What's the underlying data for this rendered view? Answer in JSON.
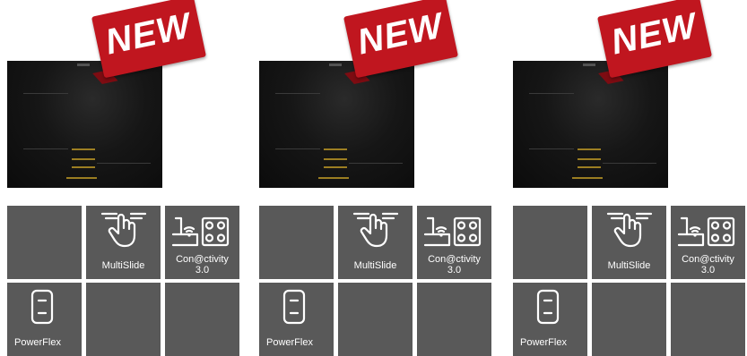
{
  "products": [
    {
      "badge": "NEW",
      "features": [
        {
          "label": "",
          "icon": ""
        },
        {
          "label": "MultiSlide",
          "icon": "multislide-hand-icon"
        },
        {
          "label": "Con@ctivity\n3.0",
          "icon": "connectivity-hood-hob-icon"
        },
        {
          "label": "PowerFlex",
          "icon": "powerflex-zone-icon"
        },
        {
          "label": "",
          "icon": ""
        },
        {
          "label": "",
          "icon": ""
        }
      ]
    },
    {
      "badge": "NEW",
      "features": [
        {
          "label": "",
          "icon": ""
        },
        {
          "label": "MultiSlide",
          "icon": "multislide-hand-icon"
        },
        {
          "label": "Con@ctivity\n3.0",
          "icon": "connectivity-hood-hob-icon"
        },
        {
          "label": "PowerFlex",
          "icon": "powerflex-zone-icon"
        },
        {
          "label": "",
          "icon": ""
        },
        {
          "label": "",
          "icon": ""
        }
      ]
    },
    {
      "badge": "NEW",
      "features": [
        {
          "label": "",
          "icon": ""
        },
        {
          "label": "MultiSlide",
          "icon": "multislide-hand-icon"
        },
        {
          "label": "Con@ctivity\n3.0",
          "icon": "connectivity-hood-hob-icon"
        },
        {
          "label": "PowerFlex",
          "icon": "powerflex-zone-icon"
        },
        {
          "label": "",
          "icon": ""
        },
        {
          "label": "",
          "icon": ""
        }
      ]
    }
  ],
  "colors": {
    "badge_red": "#c0161f",
    "tile_gray": "#595959",
    "hob_black": "#0b0b0b"
  }
}
